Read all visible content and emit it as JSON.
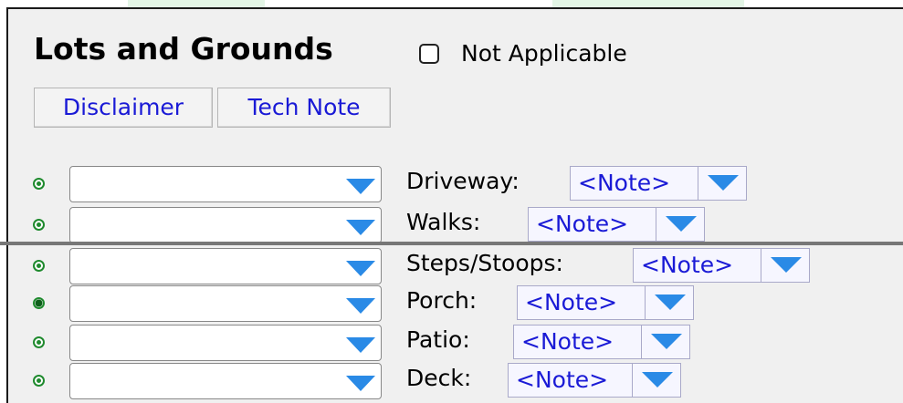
{
  "section": {
    "title": "Lots and Grounds",
    "not_applicable_label": "Not Applicable",
    "not_applicable_checked": false
  },
  "buttons": {
    "disclaimer": "Disclaimer",
    "tech_note": "Tech Note"
  },
  "rows": [
    {
      "label": "Driveway:",
      "note": "<Note>",
      "dropdown_value": "",
      "status_dot": "green-ring"
    },
    {
      "label": "Walks:",
      "note": "<Note>",
      "dropdown_value": "",
      "status_dot": "green-ring"
    },
    {
      "label": "Steps/Stoops:",
      "note": "<Note>",
      "dropdown_value": "",
      "status_dot": "green-ring"
    },
    {
      "label": "Porch:",
      "note": "<Note>",
      "dropdown_value": "",
      "status_dot": "green-filled"
    },
    {
      "label": "Patio:",
      "note": "<Note>",
      "dropdown_value": "",
      "status_dot": "green-ring"
    },
    {
      "label": "Deck:",
      "note": "<Note>",
      "dropdown_value": "",
      "status_dot": "green-ring"
    }
  ],
  "colors": {
    "accent_arrow": "#2a8ae6",
    "link_text": "#1a1ad6",
    "status_green": "#1f8a2e"
  }
}
